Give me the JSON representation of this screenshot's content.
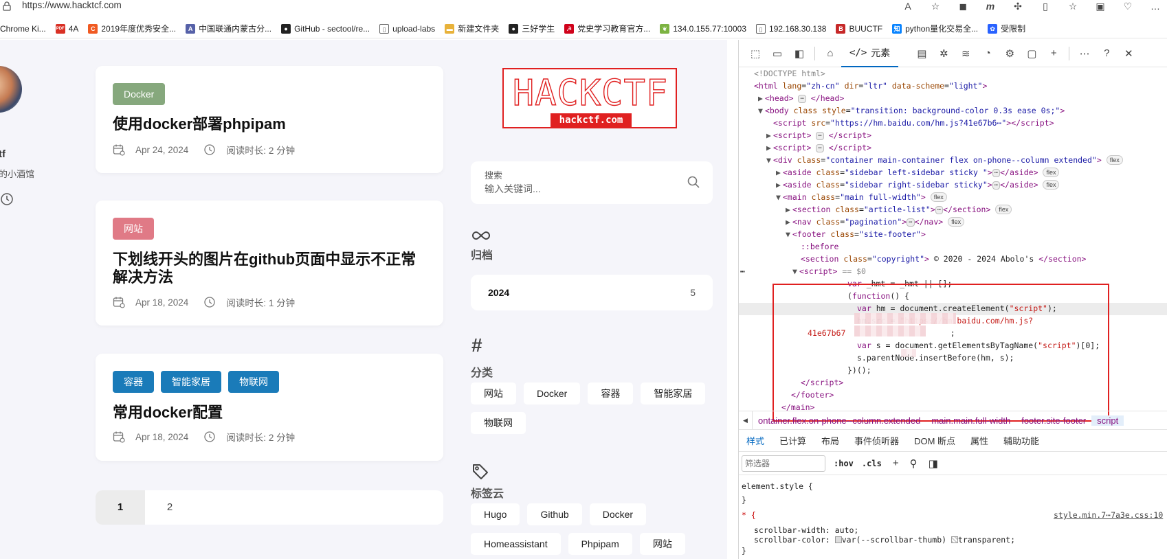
{
  "browser": {
    "url": "https://www.hacktcf.com",
    "bookmarks": [
      {
        "label": "Chrome Ki...",
        "icon": "none",
        "color": "#ffffff"
      },
      {
        "label": "4A",
        "icon": "pdf-icon",
        "color": "#d93025"
      },
      {
        "label": "2019年度优秀安全...",
        "icon": "c-icon",
        "color": "#f05a22"
      },
      {
        "label": "中国联通内蒙古分...",
        "icon": "a-icon",
        "color": "#5661a8"
      },
      {
        "label": "GitHub - sectool/re...",
        "icon": "github-icon",
        "color": "#222222"
      },
      {
        "label": "upload-labs",
        "icon": "page-icon",
        "color": "#666666"
      },
      {
        "label": "新建文件夹",
        "icon": "folder-icon",
        "color": "#e8b23a"
      },
      {
        "label": "三好学生",
        "icon": "github-icon",
        "color": "#222222"
      },
      {
        "label": "党史学习教育官方...",
        "icon": "flag-icon",
        "color": "#d0021b"
      },
      {
        "label": "134.0.155.77:10003",
        "icon": "leaf-icon",
        "color": "#7cb342"
      },
      {
        "label": "192.168.30.138",
        "icon": "page-icon",
        "color": "#666666"
      },
      {
        "label": "BUUCTF",
        "icon": "buu-icon",
        "color": "#c62828"
      },
      {
        "label": "python量化交易全...",
        "icon": "zhi-icon",
        "color": "#0a84ff"
      },
      {
        "label": "受限制",
        "icon": "paw-icon",
        "color": "#2962ff"
      }
    ]
  },
  "sidebar": {
    "name": "tf",
    "desc": "的小酒馆"
  },
  "articles": [
    {
      "tags": [
        {
          "label": "Docker",
          "color": "#86a87d"
        }
      ],
      "title": "使用docker部署phpipam",
      "date": "Apr 24, 2024",
      "readtime": "阅读时长: 2 分钟"
    },
    {
      "tags": [
        {
          "label": "网站",
          "color": "#e07a86"
        }
      ],
      "title": "下划线开头的图片在github页面中显示不正常解决方法",
      "date": "Apr 18, 2024",
      "readtime": "阅读时长: 1 分钟"
    },
    {
      "tags": [
        {
          "label": "容器",
          "color": "#1a7bb9"
        },
        {
          "label": "智能家居",
          "color": "#1a7bb9"
        },
        {
          "label": "物联网",
          "color": "#1a7bb9"
        }
      ],
      "title": "常用docker配置",
      "date": "Apr 18, 2024",
      "readtime": "阅读时长: 2 分钟"
    }
  ],
  "pagination": {
    "pages": [
      "1",
      "2"
    ],
    "current": "1"
  },
  "logo": {
    "big": "HACKCTF",
    "small": "hackctf.com"
  },
  "search": {
    "label": "搜索",
    "placeholder": "输入关键词..."
  },
  "archives": {
    "title": "归档",
    "year": "2024",
    "count": "5"
  },
  "categories": {
    "title": "分类",
    "items": [
      "网站",
      "Docker",
      "容器",
      "智能家居",
      "物联网"
    ]
  },
  "tagcloud": {
    "title": "标签云",
    "items": [
      "Hugo",
      "Github",
      "Docker",
      "Homeassistant",
      "Phpipam",
      "网站"
    ]
  },
  "devtools": {
    "elements_tab": "元素",
    "crumbs": [
      "ontainer.flex.on-phone--column.extended",
      "main.main.full-width",
      "footer.site-footer",
      "script"
    ],
    "subtabs": [
      "样式",
      "已计算",
      "布局",
      "事件侦听器",
      "DOM 断点",
      "属性",
      "辅助功能"
    ],
    "filter_placeholder": "筛选器",
    "hov": ":hov",
    "cls": ".cls",
    "styles_lines": [
      "element.style {",
      "}",
      "* {",
      "scrollbar-width: auto;",
      "scrollbar-color:",
      "var(--scrollbar-thumb)",
      "transparent;",
      "}"
    ],
    "style_link": "style.min.7⋯7a3e.css:10"
  }
}
